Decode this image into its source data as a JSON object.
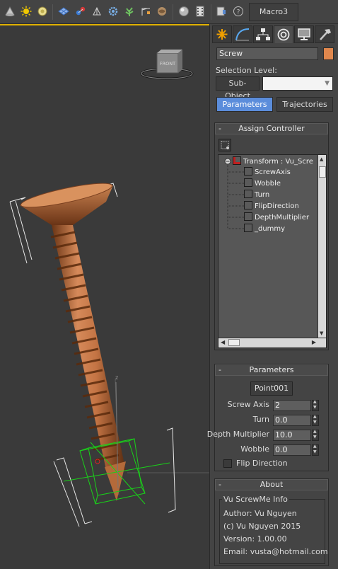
{
  "toolbar": {
    "macro_label": "Macro3",
    "icons": [
      "cone-icon",
      "sun-icon",
      "sphere-icon",
      "grid-icon",
      "molecule-icon",
      "axis-icon",
      "gear-icon",
      "plant-icon",
      "crane-icon",
      "pattern-icon",
      "shaded-sphere-icon",
      "film-strip-icon",
      "list-icon",
      "help-icon"
    ]
  },
  "viewport": {
    "viewcube_label": "FRONT",
    "axis_label": "z",
    "accent": "#e0b000"
  },
  "command_panel": {
    "tabs": [
      "create-tab",
      "modify-tab",
      "hierarchy-tab",
      "motion-tab",
      "display-tab",
      "utilities-tab"
    ],
    "object_name": "Screw",
    "object_color": "#e0874d",
    "selection_level_label": "Selection Level:",
    "subobject_label": "Sub-Object",
    "param_tabs": {
      "parameters": "Parameters",
      "trajectories": "Trajectories"
    }
  },
  "assign_controller": {
    "title": "Assign Controller",
    "tree_root": "Transform : Vu_Scre",
    "tree_items": [
      "ScrewAxis",
      "Wobble",
      "Turn",
      "FlipDirection",
      "DepthMultiplier",
      "_dummy"
    ]
  },
  "parameters": {
    "title": "Parameters",
    "point_button": "Point001",
    "screw_axis_label": "Screw Axis",
    "screw_axis_value": "2",
    "turn_label": "Turn",
    "turn_value": "0.0",
    "depth_multiplier_label": "Depth Multiplier",
    "depth_multiplier_value": "10.0",
    "wobble_label": "Wobble",
    "wobble_value": "0.0",
    "flip_direction_label": "Flip Direction",
    "flip_direction_checked": false
  },
  "about": {
    "title": "About",
    "group_title": "Vu ScrewMe Info",
    "author": "Author: Vu Nguyen",
    "copyright": "(c) Vu Nguyen 2015",
    "version": "Version: 1.00.00",
    "email": "Email: vusta@hotmail.com"
  }
}
